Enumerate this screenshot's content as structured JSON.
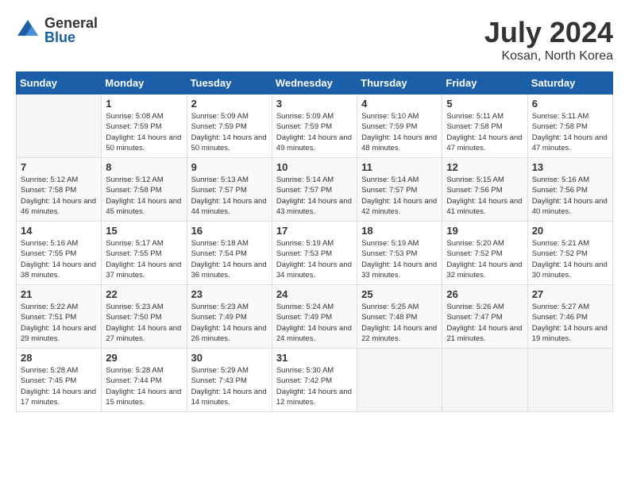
{
  "logo": {
    "general": "General",
    "blue": "Blue"
  },
  "title": "July 2024",
  "subtitle": "Kosan, North Korea",
  "days_of_week": [
    "Sunday",
    "Monday",
    "Tuesday",
    "Wednesday",
    "Thursday",
    "Friday",
    "Saturday"
  ],
  "weeks": [
    [
      {
        "day": "",
        "empty": true
      },
      {
        "day": "1",
        "sunrise": "5:08 AM",
        "sunset": "7:59 PM",
        "daylight": "14 hours and 50 minutes."
      },
      {
        "day": "2",
        "sunrise": "5:09 AM",
        "sunset": "7:59 PM",
        "daylight": "14 hours and 50 minutes."
      },
      {
        "day": "3",
        "sunrise": "5:09 AM",
        "sunset": "7:59 PM",
        "daylight": "14 hours and 49 minutes."
      },
      {
        "day": "4",
        "sunrise": "5:10 AM",
        "sunset": "7:59 PM",
        "daylight": "14 hours and 48 minutes."
      },
      {
        "day": "5",
        "sunrise": "5:11 AM",
        "sunset": "7:58 PM",
        "daylight": "14 hours and 47 minutes."
      },
      {
        "day": "6",
        "sunrise": "5:11 AM",
        "sunset": "7:58 PM",
        "daylight": "14 hours and 47 minutes."
      }
    ],
    [
      {
        "day": "7",
        "sunrise": "5:12 AM",
        "sunset": "7:58 PM",
        "daylight": "14 hours and 46 minutes."
      },
      {
        "day": "8",
        "sunrise": "5:12 AM",
        "sunset": "7:58 PM",
        "daylight": "14 hours and 45 minutes."
      },
      {
        "day": "9",
        "sunrise": "5:13 AM",
        "sunset": "7:57 PM",
        "daylight": "14 hours and 44 minutes."
      },
      {
        "day": "10",
        "sunrise": "5:14 AM",
        "sunset": "7:57 PM",
        "daylight": "14 hours and 43 minutes."
      },
      {
        "day": "11",
        "sunrise": "5:14 AM",
        "sunset": "7:57 PM",
        "daylight": "14 hours and 42 minutes."
      },
      {
        "day": "12",
        "sunrise": "5:15 AM",
        "sunset": "7:56 PM",
        "daylight": "14 hours and 41 minutes."
      },
      {
        "day": "13",
        "sunrise": "5:16 AM",
        "sunset": "7:56 PM",
        "daylight": "14 hours and 40 minutes."
      }
    ],
    [
      {
        "day": "14",
        "sunrise": "5:16 AM",
        "sunset": "7:55 PM",
        "daylight": "14 hours and 38 minutes."
      },
      {
        "day": "15",
        "sunrise": "5:17 AM",
        "sunset": "7:55 PM",
        "daylight": "14 hours and 37 minutes."
      },
      {
        "day": "16",
        "sunrise": "5:18 AM",
        "sunset": "7:54 PM",
        "daylight": "14 hours and 36 minutes."
      },
      {
        "day": "17",
        "sunrise": "5:19 AM",
        "sunset": "7:53 PM",
        "daylight": "14 hours and 34 minutes."
      },
      {
        "day": "18",
        "sunrise": "5:19 AM",
        "sunset": "7:53 PM",
        "daylight": "14 hours and 33 minutes."
      },
      {
        "day": "19",
        "sunrise": "5:20 AM",
        "sunset": "7:52 PM",
        "daylight": "14 hours and 32 minutes."
      },
      {
        "day": "20",
        "sunrise": "5:21 AM",
        "sunset": "7:52 PM",
        "daylight": "14 hours and 30 minutes."
      }
    ],
    [
      {
        "day": "21",
        "sunrise": "5:22 AM",
        "sunset": "7:51 PM",
        "daylight": "14 hours and 29 minutes."
      },
      {
        "day": "22",
        "sunrise": "5:23 AM",
        "sunset": "7:50 PM",
        "daylight": "14 hours and 27 minutes."
      },
      {
        "day": "23",
        "sunrise": "5:23 AM",
        "sunset": "7:49 PM",
        "daylight": "14 hours and 26 minutes."
      },
      {
        "day": "24",
        "sunrise": "5:24 AM",
        "sunset": "7:49 PM",
        "daylight": "14 hours and 24 minutes."
      },
      {
        "day": "25",
        "sunrise": "5:25 AM",
        "sunset": "7:48 PM",
        "daylight": "14 hours and 22 minutes."
      },
      {
        "day": "26",
        "sunrise": "5:26 AM",
        "sunset": "7:47 PM",
        "daylight": "14 hours and 21 minutes."
      },
      {
        "day": "27",
        "sunrise": "5:27 AM",
        "sunset": "7:46 PM",
        "daylight": "14 hours and 19 minutes."
      }
    ],
    [
      {
        "day": "28",
        "sunrise": "5:28 AM",
        "sunset": "7:45 PM",
        "daylight": "14 hours and 17 minutes."
      },
      {
        "day": "29",
        "sunrise": "5:28 AM",
        "sunset": "7:44 PM",
        "daylight": "14 hours and 15 minutes."
      },
      {
        "day": "30",
        "sunrise": "5:29 AM",
        "sunset": "7:43 PM",
        "daylight": "14 hours and 14 minutes."
      },
      {
        "day": "31",
        "sunrise": "5:30 AM",
        "sunset": "7:42 PM",
        "daylight": "14 hours and 12 minutes."
      },
      {
        "day": "",
        "empty": true
      },
      {
        "day": "",
        "empty": true
      },
      {
        "day": "",
        "empty": true
      }
    ]
  ]
}
